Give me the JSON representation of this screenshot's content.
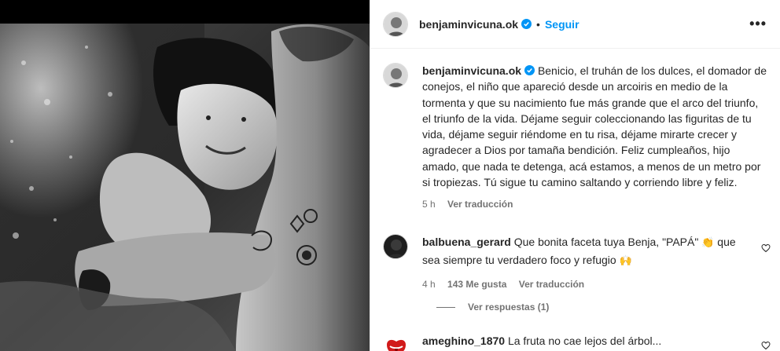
{
  "header": {
    "username": "benjaminvicuna.ok",
    "follow_label": "Seguir",
    "more_label": "•••"
  },
  "caption": {
    "username": "benjaminvicuna.ok",
    "text": "Benicio, el truhán de los dulces, el domador de conejos, el niño que apareció desde un arcoiris en medio de la tormenta y que su nacimiento fue más grande que el arco del triunfo, el triunfo de la vida. Déjame seguir coleccionando las figuritas de tu vida, déjame seguir riéndome en tu risa, déjame mirarte crecer y agradecer a Dios por tamaña bendición. Feliz cumpleaños, hijo amado, que nada te detenga, acá estamos, a menos de un metro por si tropiezas. Tú sigue tu camino saltando y corriendo libre y feliz.",
    "time": "5 h",
    "translate_label": "Ver traducción"
  },
  "comments": [
    {
      "username": "balbuena_gerard",
      "text": "Que bonita faceta tuya Benja, \"PAPÁ\"",
      "emoji1": "👏",
      "text2": "que sea siempre tu verdadero foco y refugio",
      "emoji2": "🙌",
      "time": "4 h",
      "likes": "143 Me gusta",
      "translate_label": "Ver traducción",
      "replies_label": "Ver respuestas (1)"
    },
    {
      "username": "ameghino_1870",
      "text": "La fruta no cae lejos del árbol..."
    }
  ],
  "colors": {
    "accent": "#0095f6",
    "verified": "#0095f6",
    "secondary_text": "#737373"
  }
}
